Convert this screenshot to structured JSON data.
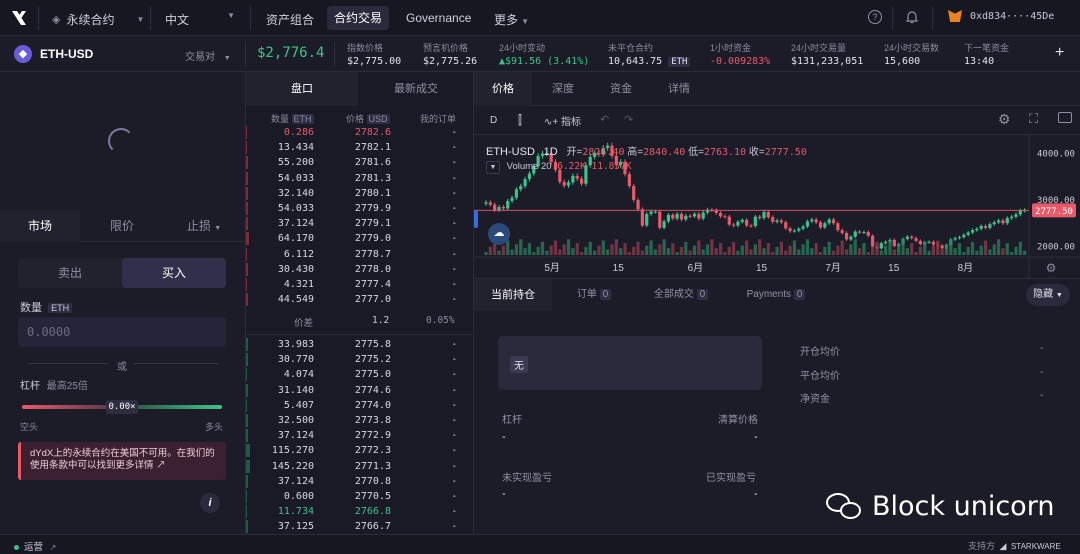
{
  "nav": {
    "market_name": "永续合约",
    "language": "中文",
    "links": [
      "资产组合",
      "合约交易",
      "Governance",
      "更多"
    ],
    "wallet": "0xd834····45De"
  },
  "ticker": {
    "pair": "ETH-USD",
    "pair_menu": "交易对",
    "price": "$2,776.4",
    "stats": [
      {
        "label": "指数价格",
        "value": "$2,775.00",
        "tone": "plain"
      },
      {
        "label": "预言机价格",
        "value": "$2,775.26",
        "tone": "plain"
      },
      {
        "label": "24小时变动",
        "value": "▲$91.56 (3.41%)",
        "tone": "green"
      },
      {
        "label": "未平仓合约",
        "value": "10,643.75",
        "unit": "ETH",
        "tone": "plain"
      },
      {
        "label": "1小时资金",
        "value": "-0.009283%",
        "tone": "red"
      },
      {
        "label": "24小时交易量",
        "value": "$131,233,051",
        "tone": "plain"
      },
      {
        "label": "24小时交易数",
        "value": "15,600",
        "tone": "plain"
      },
      {
        "label": "下一笔资金",
        "value": "13:40",
        "tone": "plain"
      }
    ]
  },
  "order_form": {
    "tabs": [
      "市场",
      "限价",
      "止损"
    ],
    "sell": "卖出",
    "buy": "买入",
    "amount_label": "数量",
    "amount_unit": "ETH",
    "amount_placeholder": "0.0000",
    "or": "或",
    "leverage_label": "杠杆",
    "leverage_max": "最高25倍",
    "leverage_value": "0.00×",
    "short": "空头",
    "long": "多头",
    "warning": "dYdX上的永续合约在美国不可用。在我们的使用条款中可以找到更多详情 ↗"
  },
  "book": {
    "tabs": [
      "盘口",
      "最新成交"
    ],
    "headers": {
      "size": "数量",
      "size_unit": "ETH",
      "price": "价格",
      "price_unit": "USD",
      "mine": "我的订单"
    },
    "asks": [
      [
        "0.286",
        "2782.6"
      ],
      [
        "13.434",
        "2782.1"
      ],
      [
        "55.200",
        "2781.6"
      ],
      [
        "54.033",
        "2781.3"
      ],
      [
        "32.140",
        "2780.1"
      ],
      [
        "54.033",
        "2779.9"
      ],
      [
        "37.124",
        "2779.1"
      ],
      [
        "64.170",
        "2779.0"
      ],
      [
        "6.112",
        "2778.7"
      ],
      [
        "30.430",
        "2778.0"
      ],
      [
        "4.321",
        "2777.4"
      ],
      [
        "44.549",
        "2777.0"
      ]
    ],
    "spread": {
      "label": "价差",
      "value": "1.2",
      "pct": "0.05%"
    },
    "bids": [
      [
        "33.983",
        "2775.8"
      ],
      [
        "30.770",
        "2775.2"
      ],
      [
        "4.074",
        "2775.0"
      ],
      [
        "31.140",
        "2774.6"
      ],
      [
        "5.407",
        "2774.0"
      ],
      [
        "32.500",
        "2773.8"
      ],
      [
        "37.124",
        "2772.9"
      ],
      [
        "115.270",
        "2772.3"
      ],
      [
        "145.220",
        "2771.3"
      ],
      [
        "37.124",
        "2770.8"
      ],
      [
        "0.600",
        "2770.5"
      ],
      [
        "11.734",
        "2766.8"
      ],
      [
        "37.125",
        "2766.7"
      ]
    ],
    "dash": "-"
  },
  "chart": {
    "tabs": [
      "价格",
      "深度",
      "资金",
      "详情"
    ],
    "interval": "D",
    "indicator": "指标",
    "title": "ETH-USD",
    "tf": "1D",
    "ohlc": {
      "o_label": "开=",
      "o": "2826.40",
      "h_label": "高=",
      "h": "2840.40",
      "l_label": "低=",
      "l": "2763.10",
      "c_label": "收=",
      "c": "2777.50"
    },
    "volume_label": "Volume 20",
    "volume_vals": "6.22K  11.857K",
    "yticks": [
      "4000.00",
      "3000.00",
      "2000.00"
    ],
    "current": "2777.50",
    "xticks": [
      "5月",
      "15",
      "6月",
      "15",
      "7月",
      "15",
      "8月"
    ]
  },
  "chart_data": {
    "type": "candlestick",
    "title": "ETH-USD",
    "interval": "1D",
    "ylim": [
      1600,
      4400
    ],
    "closes": [
      2950,
      2900,
      2780,
      2850,
      2820,
      2980,
      3050,
      3230,
      3300,
      3450,
      3570,
      3730,
      3950,
      4000,
      4010,
      3820,
      3650,
      3390,
      3310,
      3380,
      3520,
      3460,
      3350,
      3750,
      3930,
      4010,
      3990,
      4120,
      4170,
      3950,
      3750,
      3820,
      3560,
      3300,
      3000,
      2800,
      2450,
      2700,
      2750,
      2750,
      2400,
      2540,
      2680,
      2600,
      2700,
      2580,
      2660,
      2650,
      2700,
      2600,
      2730,
      2790,
      2780,
      2720,
      2650,
      2640,
      2470,
      2450,
      2530,
      2570,
      2450,
      2440,
      2640,
      2610,
      2740,
      2630,
      2530,
      2560,
      2520,
      2390,
      2330,
      2340,
      2380,
      2430,
      2540,
      2580,
      2520,
      2410,
      2500,
      2580,
      2500,
      2350,
      2290,
      2150,
      2210,
      2320,
      2300,
      2310,
      2230,
      2000,
      1960,
      2070,
      2100,
      2140,
      2010,
      2050,
      2160,
      2210,
      2180,
      2120,
      2050,
      2090,
      2100,
      2040,
      2020,
      1960,
      2030,
      2150,
      2180,
      2200,
      2250,
      2300,
      2350,
      2380,
      2440,
      2400,
      2480,
      2520,
      2560,
      2500,
      2610,
      2640,
      2690,
      2770,
      2780
    ]
  },
  "positions": {
    "tabs": [
      {
        "name": "当前持仓",
        "count": ""
      },
      {
        "name": "订单",
        "count": "0"
      },
      {
        "name": "全部成交",
        "count": "0"
      },
      {
        "name": "Payments",
        "count": "0"
      }
    ],
    "hide": "隐藏",
    "none": "无",
    "leverage": "杠杆",
    "liq": "清算价格",
    "unrealized": "未实现盈亏",
    "realized": "已实现盈亏",
    "dash": "-",
    "right": [
      "开仓均价",
      "平仓均价",
      "净资金"
    ]
  },
  "footer": {
    "status": "运营",
    "powered": "支持方",
    "brand": "STARKWARE"
  },
  "watermark": "Block unicorn"
}
